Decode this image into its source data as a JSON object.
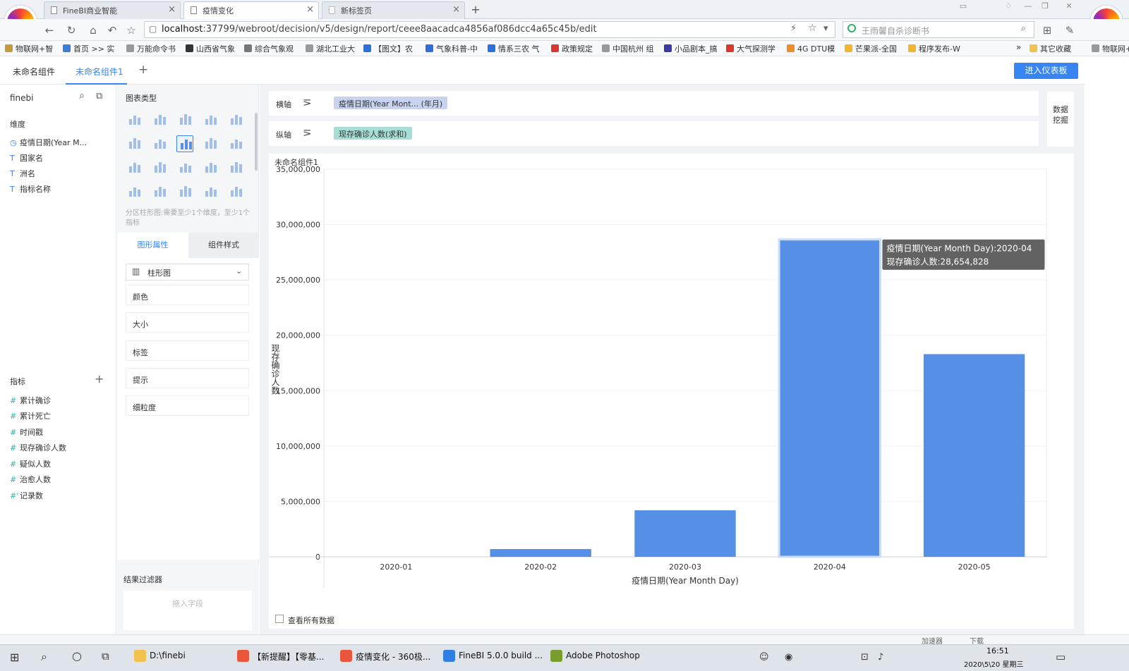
{
  "browser": {
    "tabs": [
      {
        "label": "FineBI商业智能",
        "active": false
      },
      {
        "label": "疫情变化",
        "active": true
      },
      {
        "label": "新标签页",
        "active": false
      }
    ],
    "url_host": "localhost",
    "url_rest": ":37799/webroot/decision/v5/design/report/ceee8aacadca4856af086dcc4a65c45b/edit",
    "search_placeholder": "王雨馨自杀诊断书",
    "bookmarks": [
      "物联网+智",
      "首页 >> 实",
      "万能命令书",
      "山西省气象",
      "综合气象观",
      "湖北工业大",
      "【图文】农",
      "气象科普-中",
      "情系三农 气",
      "政策规定",
      "中国杭州 组",
      "小品剧本_搞",
      "大气探测学",
      "4G DTU模",
      "芒果派-全国",
      "程序发布-W"
    ],
    "bookmark_more": "»",
    "bookmark_folder": "其它收藏",
    "bookmark_right": "物联网+"
  },
  "app": {
    "component_tabs": [
      "未命名组件",
      "未命名组件1"
    ],
    "add_tab": "+",
    "enter_dashboard": "进入仪表板"
  },
  "left": {
    "dataset": "finebi",
    "dimension_title": "维度",
    "dimensions": [
      {
        "icon": "◷",
        "label": "疫情日期(Year M..."
      },
      {
        "icon": "T",
        "label": "国家名"
      },
      {
        "icon": "T",
        "label": "洲名"
      },
      {
        "icon": "T",
        "label": "指标名称"
      }
    ],
    "metric_title": "指标",
    "metric_add": "+",
    "metrics": [
      {
        "icon": "#",
        "label": "累计确诊"
      },
      {
        "icon": "#",
        "label": "累计死亡"
      },
      {
        "icon": "#",
        "label": "时间戳"
      },
      {
        "icon": "#",
        "label": "现存确诊人数"
      },
      {
        "icon": "#",
        "label": "疑似人数"
      },
      {
        "icon": "#",
        "label": "治愈人数"
      },
      {
        "icon": "#'",
        "label": "记录数"
      }
    ]
  },
  "middle": {
    "chart_type_title": "图表类型",
    "chart_hint": "分区柱形图:需要至少1个维度，至少1个指标",
    "prop_tabs": [
      "图形属性",
      "组件样式"
    ],
    "chart_select": "柱形图",
    "props": [
      "颜色",
      "大小",
      "标签",
      "提示",
      "细粒度"
    ],
    "filter_title": "结果过滤器",
    "filter_drop": "拖入字段"
  },
  "axes": {
    "x_label": "横轴",
    "x_field": "疫情日期(Year Mont... (年月)",
    "y_label": "纵轴",
    "y_field": "现存确诊人数(求和)",
    "data_mining": "数据挖掘"
  },
  "chart_card": {
    "title": "未命名组件1",
    "view_all": "查看所有数据"
  },
  "chart_data": {
    "type": "bar",
    "categories": [
      "2020-01",
      "2020-02",
      "2020-03",
      "2020-04",
      "2020-05"
    ],
    "values": [
      0,
      700000,
      4200000,
      28654828,
      18300000
    ],
    "xlabel": "疫情日期(Year Month Day)",
    "ylabel": "现存确诊人数",
    "ylim": [
      0,
      35000000
    ],
    "yticks": [
      "0",
      "5,000,000",
      "10,000,000",
      "15,000,000",
      "20,000,000",
      "25,000,000",
      "30,000,000",
      "35,000,000"
    ],
    "bar_color": "#5590e6",
    "tooltip": {
      "line1": "疫情日期(Year Month Day):2020-04",
      "line2": "现存确诊人数:28,654,828"
    }
  },
  "taskbar": {
    "status_items": [
      "加速器",
      "下载"
    ],
    "tasks": [
      "D:\\finebi",
      "【新提醒】【零基...",
      "疫情变化 - 360极...",
      "FineBI 5.0.0 build ...",
      "Adobe Photoshop"
    ],
    "time": "16:51",
    "date": "2020\\5\\20 星期三"
  }
}
